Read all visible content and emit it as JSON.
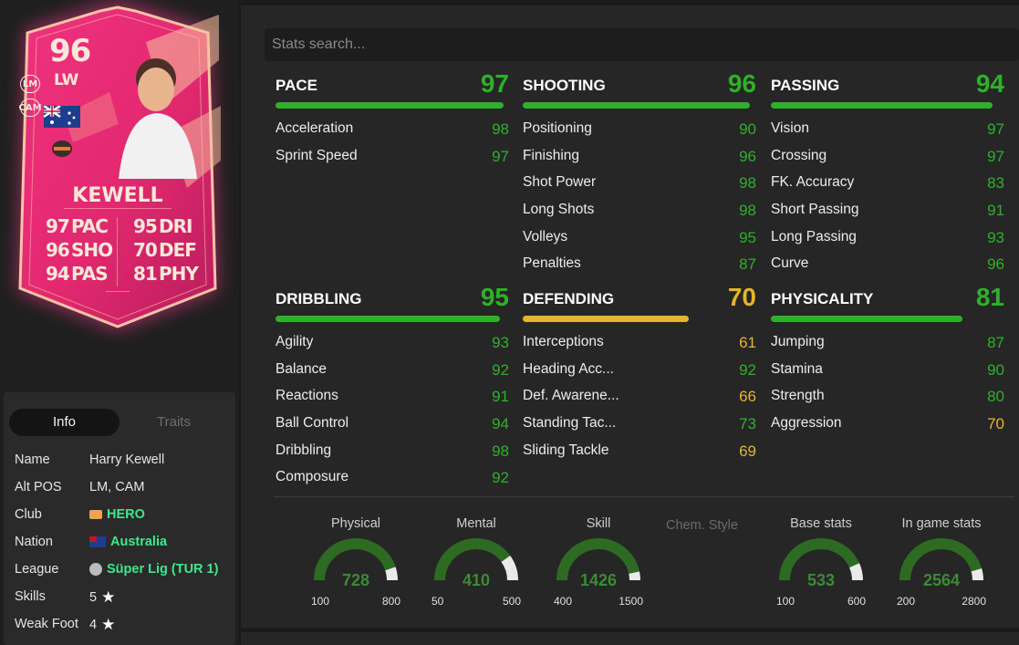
{
  "colors": {
    "green": "#2fb02a",
    "yellow": "#e5b52a",
    "gauge_green": "#2d6b22",
    "gauge_rest": "#eaeaea",
    "link_green": "#3ee88b"
  },
  "card": {
    "rating": "96",
    "position": "LW",
    "alt_positions": [
      "LM",
      "CAM"
    ],
    "name": "KEWELL",
    "stats_left": [
      {
        "value": "97",
        "label": "PAC"
      },
      {
        "value": "96",
        "label": "SHO"
      },
      {
        "value": "94",
        "label": "PAS"
      }
    ],
    "stats_right": [
      {
        "value": "95",
        "label": "DRI"
      },
      {
        "value": "70",
        "label": "DEF"
      },
      {
        "value": "81",
        "label": "PHY"
      }
    ],
    "flag_icon": "australia-flag-icon",
    "club_icon": "club-crest-icon"
  },
  "info": {
    "tabs": [
      "Info",
      "Traits"
    ],
    "rows": [
      {
        "key": "Name",
        "value": "Harry Kewell",
        "icon": null
      },
      {
        "key": "Alt POS",
        "value": "LM, CAM",
        "icon": null
      },
      {
        "key": "Club",
        "value": "HERO",
        "icon": "club-icon"
      },
      {
        "key": "Nation",
        "value": "Australia",
        "icon": "flag-icon"
      },
      {
        "key": "League",
        "value": "Süper Lig (TUR 1)",
        "icon": "league-icon"
      },
      {
        "key": "Skills",
        "value": "5",
        "icon": "star-icon"
      },
      {
        "key": "Weak Foot",
        "value": "4",
        "icon": "star-icon"
      }
    ]
  },
  "search": {
    "placeholder": "Stats search..."
  },
  "categories": [
    {
      "title": "PACE",
      "value": "97",
      "color": "green",
      "bar_fraction": 0.97,
      "stats": [
        {
          "name": "Acceleration",
          "value": "98",
          "color": "green"
        },
        {
          "name": "Sprint Speed",
          "value": "97",
          "color": "green"
        }
      ]
    },
    {
      "title": "SHOOTING",
      "value": "96",
      "color": "green",
      "bar_fraction": 0.96,
      "stats": [
        {
          "name": "Positioning",
          "value": "90",
          "color": "green"
        },
        {
          "name": "Finishing",
          "value": "96",
          "color": "green"
        },
        {
          "name": "Shot Power",
          "value": "98",
          "color": "green"
        },
        {
          "name": "Long Shots",
          "value": "98",
          "color": "green"
        },
        {
          "name": "Volleys",
          "value": "95",
          "color": "green"
        },
        {
          "name": "Penalties",
          "value": "87",
          "color": "green"
        }
      ]
    },
    {
      "title": "PASSING",
      "value": "94",
      "color": "green",
      "bar_fraction": 0.94,
      "stats": [
        {
          "name": "Vision",
          "value": "97",
          "color": "green"
        },
        {
          "name": "Crossing",
          "value": "97",
          "color": "green"
        },
        {
          "name": "FK. Accuracy",
          "value": "83",
          "color": "green"
        },
        {
          "name": "Short Passing",
          "value": "91",
          "color": "green"
        },
        {
          "name": "Long Passing",
          "value": "93",
          "color": "green"
        },
        {
          "name": "Curve",
          "value": "96",
          "color": "green"
        }
      ]
    },
    {
      "title": "DRIBBLING",
      "value": "95",
      "color": "green",
      "bar_fraction": 0.95,
      "stats": [
        {
          "name": "Agility",
          "value": "93",
          "color": "green"
        },
        {
          "name": "Balance",
          "value": "92",
          "color": "green"
        },
        {
          "name": "Reactions",
          "value": "91",
          "color": "green"
        },
        {
          "name": "Ball Control",
          "value": "94",
          "color": "green"
        },
        {
          "name": "Dribbling",
          "value": "98",
          "color": "green"
        },
        {
          "name": "Composure",
          "value": "92",
          "color": "green"
        }
      ]
    },
    {
      "title": "DEFENDING",
      "value": "70",
      "color": "yellow",
      "bar_fraction": 0.7,
      "stats": [
        {
          "name": "Interceptions",
          "value": "61",
          "color": "yellow"
        },
        {
          "name": "Heading Acc...",
          "value": "92",
          "color": "green"
        },
        {
          "name": "Def. Awarene...",
          "value": "66",
          "color": "yellow"
        },
        {
          "name": "Standing Tac...",
          "value": "73",
          "color": "green"
        },
        {
          "name": "Sliding Tackle",
          "value": "69",
          "color": "yellow"
        }
      ]
    },
    {
      "title": "PHYSICALITY",
      "value": "81",
      "color": "green",
      "bar_fraction": 0.81,
      "stats": [
        {
          "name": "Jumping",
          "value": "87",
          "color": "green"
        },
        {
          "name": "Stamina",
          "value": "90",
          "color": "green"
        },
        {
          "name": "Strength",
          "value": "80",
          "color": "green"
        },
        {
          "name": "Aggression",
          "value": "70",
          "color": "yellow"
        }
      ]
    }
  ],
  "gauges": [
    {
      "label": "Physical",
      "value": "728",
      "min": "100",
      "max": "800"
    },
    {
      "label": "Mental",
      "value": "410",
      "min": "50",
      "max": "500"
    },
    {
      "label": "Skill",
      "value": "1426",
      "min": "400",
      "max": "1500"
    },
    {
      "label": "Base stats",
      "value": "533",
      "min": "100",
      "max": "600"
    },
    {
      "label": "In game stats",
      "value": "2564",
      "min": "200",
      "max": "2800"
    }
  ],
  "chem_style": "Chem. Style"
}
